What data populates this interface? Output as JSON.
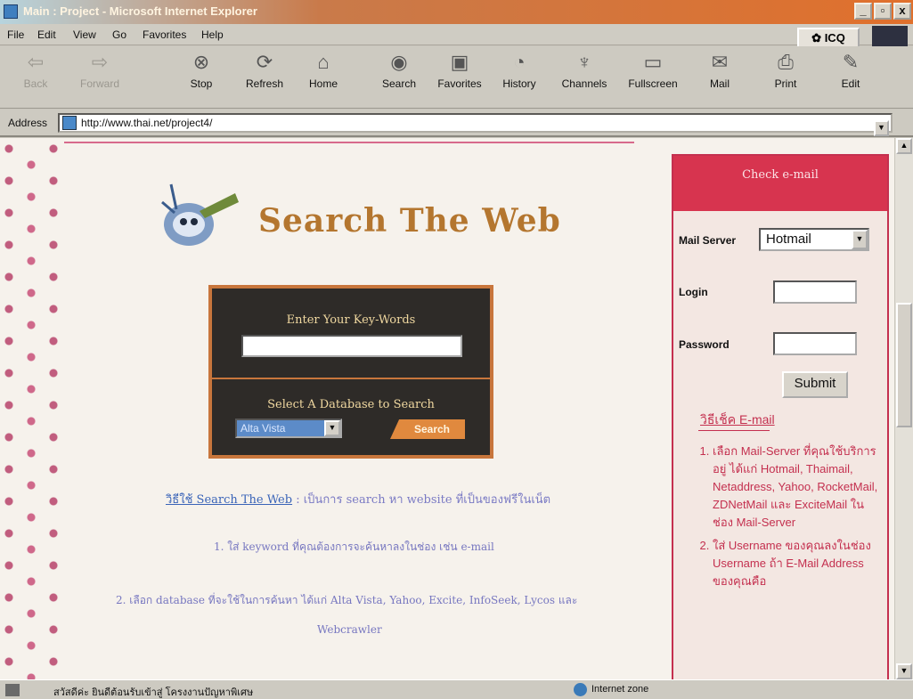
{
  "window": {
    "title": "Main : Project - Microsoft Internet Explorer",
    "controls": [
      "_",
      "▫",
      "x"
    ]
  },
  "menu": {
    "items": [
      "File",
      "Edit",
      "View",
      "Go",
      "Favorites",
      "Help"
    ],
    "icq_label": "ICQ"
  },
  "toolbar": {
    "buttons": [
      {
        "label": "Back",
        "icon": "back-arrow-icon",
        "enabled": false
      },
      {
        "label": "Forward",
        "icon": "forward-arrow-icon",
        "enabled": false
      },
      {
        "label": "Stop",
        "icon": "stop-icon",
        "enabled": true
      },
      {
        "label": "Refresh",
        "icon": "refresh-icon",
        "enabled": true
      },
      {
        "label": "Home",
        "icon": "home-icon",
        "enabled": true
      },
      {
        "label": "Search",
        "icon": "search-icon",
        "enabled": true
      },
      {
        "label": "Favorites",
        "icon": "favorites-icon",
        "enabled": true
      },
      {
        "label": "History",
        "icon": "history-icon",
        "enabled": true
      },
      {
        "label": "Channels",
        "icon": "channels-icon",
        "enabled": true
      },
      {
        "label": "Fullscreen",
        "icon": "fullscreen-icon",
        "enabled": true
      },
      {
        "label": "Mail",
        "icon": "mail-icon",
        "enabled": true
      },
      {
        "label": "Print",
        "icon": "print-icon",
        "enabled": true
      },
      {
        "label": "Edit",
        "icon": "edit-icon",
        "enabled": true
      }
    ]
  },
  "address": {
    "label": "Address",
    "url": "http://www.thai.net/project4/"
  },
  "page": {
    "title": "Search The Web",
    "search_panel": {
      "keyword_label": "Enter Your Key-Words",
      "keyword_value": "",
      "database_label": "Select A Database to Search",
      "database_selected": "Alta Vista",
      "search_button": "Search"
    },
    "howto_link": "วิธีใช้ Search The Web",
    "howto_text": ": เป็นการ search หา website ที่เป็นของฟรีในเน็ต",
    "step1": "1. ใส่ keyword ที่คุณต้องการจะค้นหาลงในช่อง เช่น e-mail",
    "step2": "2. เลือก database ที่จะใช้ในการค้นหา ได้แก่ Alta Vista, Yahoo, Excite, InfoSeek, Lycos และ",
    "step2_cont": "Webcrawler"
  },
  "sidebar": {
    "header": "Check e-mail",
    "mail_server_label": "Mail Server",
    "mail_server_value": "Hotmail",
    "login_label": "Login",
    "password_label": "Password",
    "submit_label": "Submit",
    "howto_link": "วิธีเช็ค E-mail",
    "steps": [
      "เลือก Mail-Server ที่คุณใช้บริการอยู่ ได้แก่ Hotmail, Thaimail, Netaddress, Yahoo, RocketMail, ZDNetMail และ ExciteMail ในช่อง Mail-Server",
      "ใส่ Username ของคุณลงในช่อง Username ถ้า E-Mail Address ของคุณคือ"
    ]
  },
  "status": {
    "message": "สวัสดีค่ะ ยินดีต้อนรับเข้าสู่ โครงงานปัญหาพิเศษ",
    "zone": "Internet zone"
  },
  "colors": {
    "title_gradient_end": "#e0702c",
    "accent_red": "#c4304f",
    "search_panel_bg": "#2e2b28",
    "search_panel_border": "#c8763c",
    "page_title": "#b4762f"
  }
}
